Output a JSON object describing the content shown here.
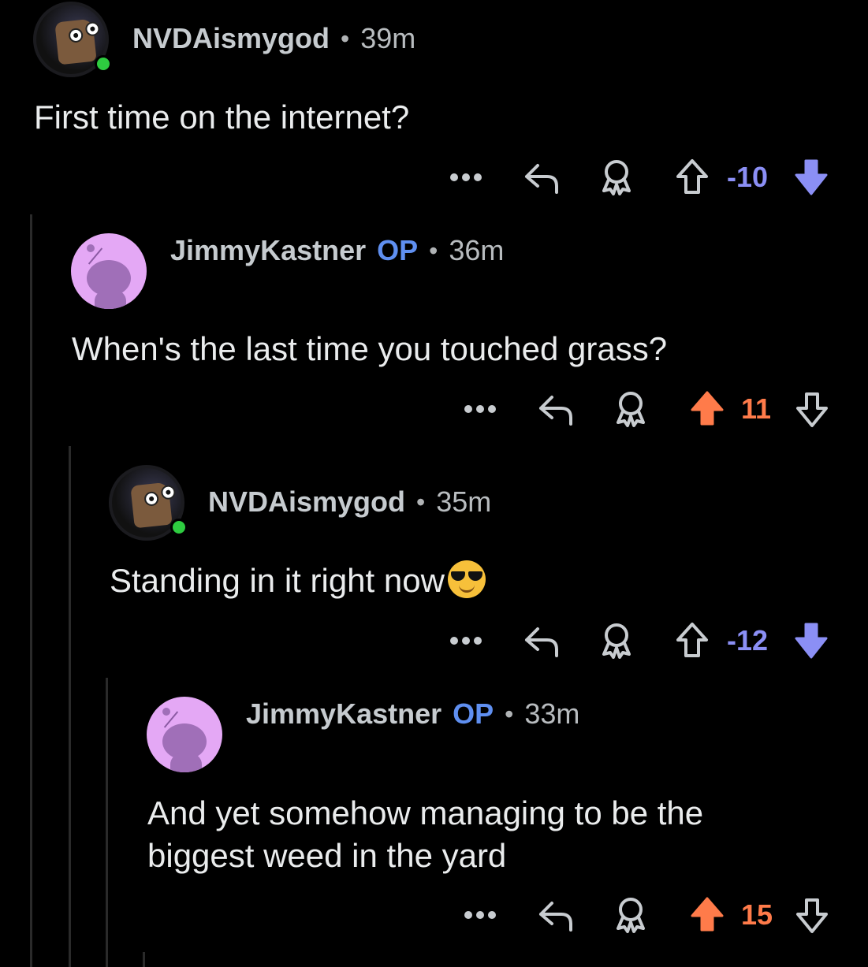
{
  "colors": {
    "background": "#000000",
    "op_badge": "#5f8ff0",
    "downvote": "#8b8ff5",
    "upvote": "#ff7b4a",
    "online": "#2ecc40"
  },
  "comments": [
    {
      "username": "NVDAismygod",
      "op_label": "",
      "time": "39m",
      "text": "First time on the internet?",
      "score": "-10",
      "vote_state": "downvoted",
      "avatar": "nvda-avatar",
      "online": true
    },
    {
      "username": "JimmyKastner",
      "op_label": "OP",
      "time": "36m",
      "text": "When's the last time you touched grass?",
      "score": "11",
      "vote_state": "upvoted",
      "avatar": "snoo-avatar",
      "online": false
    },
    {
      "username": "NVDAismygod",
      "op_label": "",
      "time": "35m",
      "text": "Standing in it right now",
      "emoji": "sunglasses-face-emoji",
      "score": "-12",
      "vote_state": "downvoted",
      "avatar": "nvda-avatar",
      "online": true
    },
    {
      "username": "JimmyKastner",
      "op_label": "OP",
      "time": "33m",
      "text_line1": "And yet somehow managing to be the",
      "text_line2": "biggest weed in the yard",
      "score": "15",
      "vote_state": "upvoted",
      "avatar": "snoo-avatar",
      "online": false
    }
  ],
  "separator": "•",
  "icons": {
    "more": "more-icon",
    "reply": "reply-icon",
    "award": "award-icon",
    "upvote": "upvote-icon",
    "downvote": "downvote-icon"
  }
}
